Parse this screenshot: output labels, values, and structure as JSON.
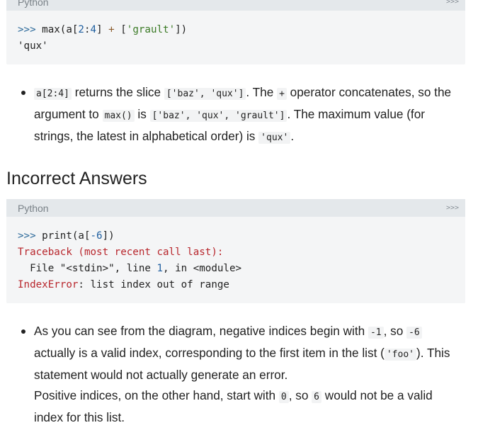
{
  "block1": {
    "language": "Python",
    "toggle": ">>>",
    "line1": {
      "prompt": ">>> ",
      "code_a": "max(a[",
      "n1": "2",
      "colon": ":",
      "n2": "4",
      "code_b": "] ",
      "plus": "+",
      "code_c": " [",
      "str": "'grault'",
      "code_d": "])"
    },
    "line2": "'qux'"
  },
  "bullet1": {
    "c1": "a[2:4]",
    "t1": " returns the slice ",
    "c2": "['baz', 'qux']",
    "t2": ". The ",
    "c3": "+",
    "t3": " operator concatenates, so the argument to ",
    "c4": "max()",
    "t4": " is ",
    "c5": "['baz', 'qux', 'grault']",
    "t5": ". The maximum value (for strings, the latest in alphabetical order) is ",
    "c6": "'qux'",
    "t6": "."
  },
  "section_heading": "Incorrect Answers",
  "block2": {
    "language": "Python",
    "toggle": ">>>",
    "line1": {
      "prompt": ">>> ",
      "code_a": "print(a[",
      "num": "-6",
      "code_b": "])"
    },
    "line2": "Traceback (most recent call last):",
    "line3": {
      "indent": "  File ",
      "file": "\"<stdin>\"",
      "sep1": ", line ",
      "lineno": "1",
      "sep2": ", in <module>"
    },
    "line4": {
      "err": "IndexError",
      "msg": ": list index out of range"
    }
  },
  "bullet2": {
    "t1": "As you can see from the diagram, negative indices begin with ",
    "c1": "-1",
    "t2": ", so ",
    "c2": "-6",
    "t3": " actually is a valid index, corresponding to the first item in the list (",
    "c3": "'foo'",
    "t4": "). This statement would not actually generate an error.",
    "t5": "Positive indices, on the other hand, start with ",
    "c4": "0",
    "t6": ", so ",
    "c5": "6",
    "t7": " would not be a valid index for this list."
  }
}
